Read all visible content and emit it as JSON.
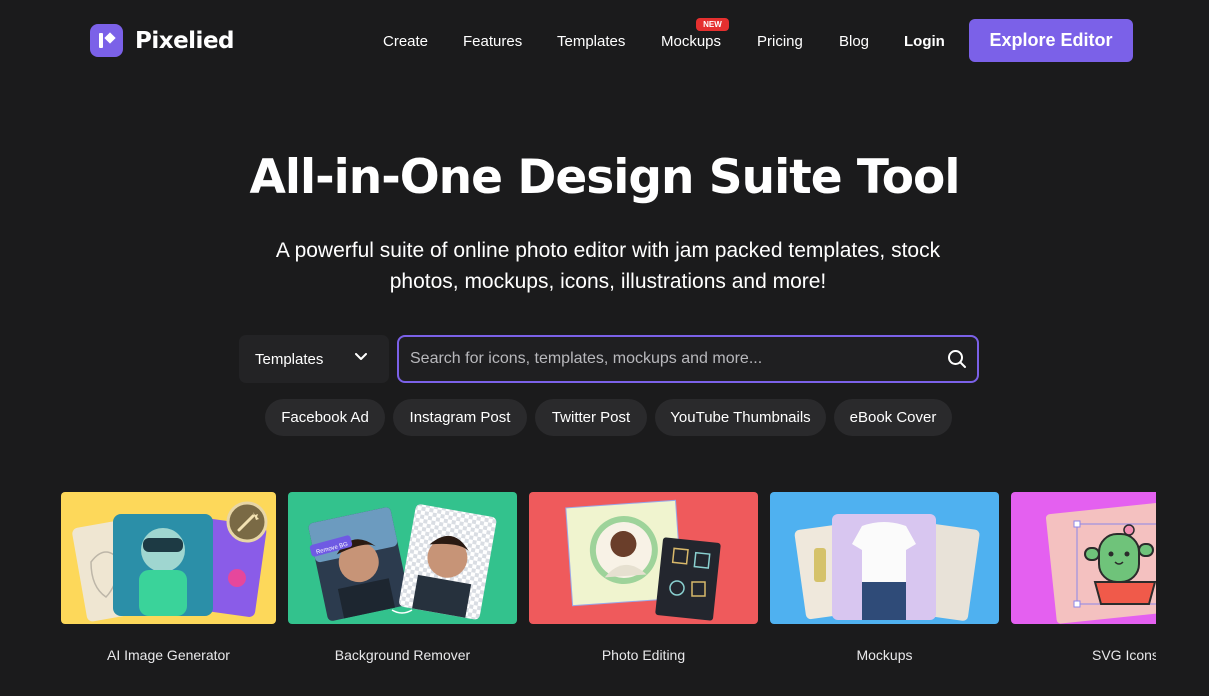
{
  "brand": {
    "name": "Pixelied"
  },
  "nav": {
    "links": [
      {
        "label": "Create"
      },
      {
        "label": "Features"
      },
      {
        "label": "Templates"
      },
      {
        "label": "Mockups"
      },
      {
        "label": "Pricing"
      },
      {
        "label": "Blog"
      },
      {
        "label": "Login"
      }
    ],
    "new_badge": "NEW",
    "cta": "Explore Editor"
  },
  "hero": {
    "title": "All-in-One Design Suite Tool",
    "subtitle": "A powerful suite of online photo editor with jam packed templates, stock photos, mockups, icons, illustrations and more!"
  },
  "search": {
    "type_selected": "Templates",
    "placeholder": "Search for icons, templates, mockups and more..."
  },
  "chips": [
    "Facebook Ad",
    "Instagram Post",
    "Twitter Post",
    "YouTube Thumbnails",
    "eBook Cover"
  ],
  "cards": [
    {
      "label": "AI Image Generator",
      "bg": "#fdd85a"
    },
    {
      "label": "Background Remover",
      "bg": "#33c28d",
      "tag": "Remove BG"
    },
    {
      "label": "Photo Editing",
      "bg": "#ef5a5c"
    },
    {
      "label": "Mockups",
      "bg": "#4fb1f0"
    },
    {
      "label": "SVG Icons",
      "bg": "#e460f0"
    }
  ],
  "colors": {
    "accent": "#7b61e8",
    "background": "#1b1b1c",
    "badge": "#e5302f"
  }
}
